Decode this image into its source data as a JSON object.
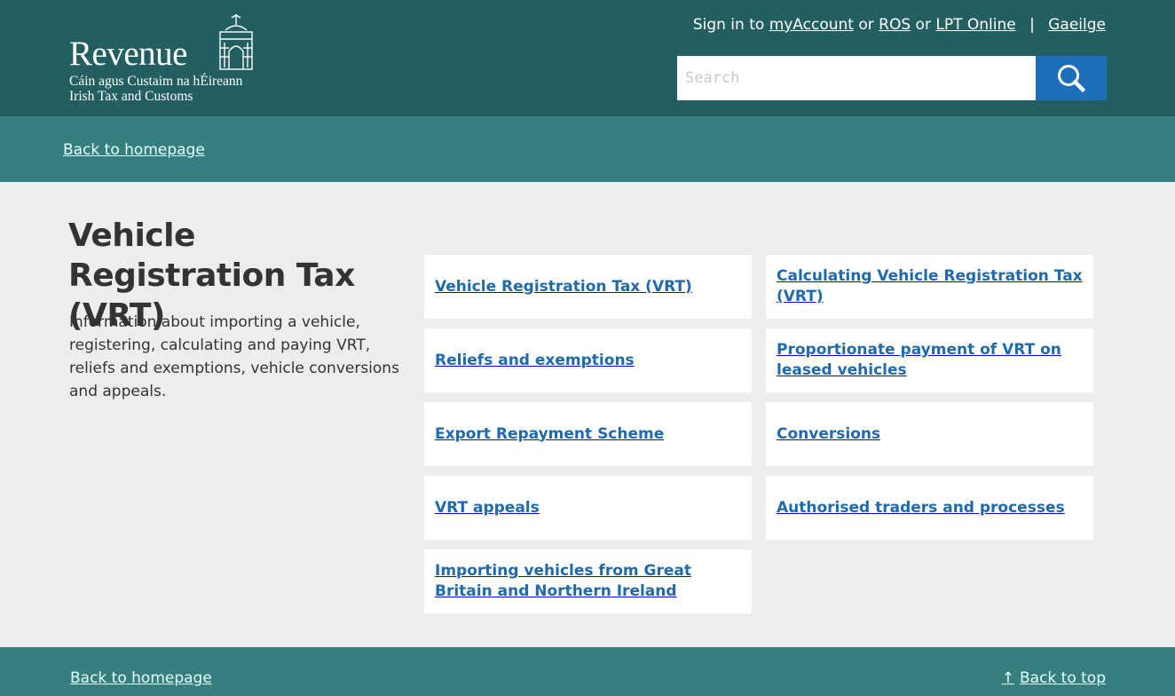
{
  "header": {
    "logo": {
      "wordmark": "Revenue",
      "subtitle_irish": "Cáin agus Custaim na hÉireann",
      "subtitle_english": "Irish Tax and Customs"
    },
    "signin": {
      "prefix": "Sign in to",
      "myaccount": "myAccount",
      "or1": "or",
      "ros": "ROS",
      "or2": "or",
      "lpt": "LPT Online",
      "separator": "|",
      "language": "Gaeilge"
    },
    "search": {
      "placeholder": "Search",
      "value": "",
      "button_icon": "search-icon"
    }
  },
  "subnav": {
    "back_link": "Back to homepage"
  },
  "intro": {
    "title": "Vehicle Registration Tax (VRT)",
    "description": "Information about importing a vehicle, registering, calculating and paying VRT, reliefs and exemptions, vehicle conversions and appeals."
  },
  "cards": [
    {
      "label": "Vehicle Registration Tax (VRT)"
    },
    {
      "label": "Calculating Vehicle Registration Tax (VRT)"
    },
    {
      "label": "Reliefs and exemptions"
    },
    {
      "label": "Proportionate payment of VRT on leased vehicles"
    },
    {
      "label": "Export Repayment Scheme"
    },
    {
      "label": "Conversions"
    },
    {
      "label": "VRT appeals"
    },
    {
      "label": "Authorised traders and processes"
    },
    {
      "label": "Importing vehicles from Great Britain and Northern Ireland"
    }
  ],
  "footer": {
    "back_home": "Back to homepage",
    "back_top_arrow": "↑",
    "back_top": "Back to top"
  },
  "colors": {
    "header_bg": "#235e60",
    "subnav_bg": "#357f7f",
    "search_button": "#1d6fba",
    "card_link": "#1e6aaa",
    "page_bg": "#ebedef"
  }
}
